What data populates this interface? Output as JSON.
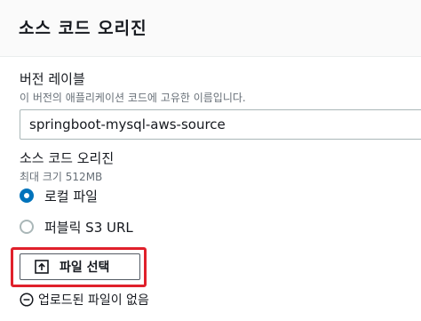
{
  "header": {
    "title": "소스 코드 오리진"
  },
  "version_label": {
    "label": "버전 레이블",
    "description": "이 버전의 애플리케이션 코드에 고유한 이름입니다.",
    "value": "springboot-mysql-aws-source"
  },
  "source_origin": {
    "label": "소스 코드 오리진",
    "max_size": "최대 크기 512MB",
    "options": [
      {
        "label": "로컬 파일",
        "selected": true
      },
      {
        "label": "퍼블릭 S3 URL",
        "selected": false
      }
    ]
  },
  "file_select": {
    "button_label": "파일 선택",
    "status": "업로드된 파일이 없음"
  },
  "colors": {
    "accent": "#0073bb",
    "highlight": "#e0202b",
    "muted_text": "#687078"
  },
  "icons": {
    "file_button": "upload-icon",
    "status": "minus-circle-icon"
  }
}
